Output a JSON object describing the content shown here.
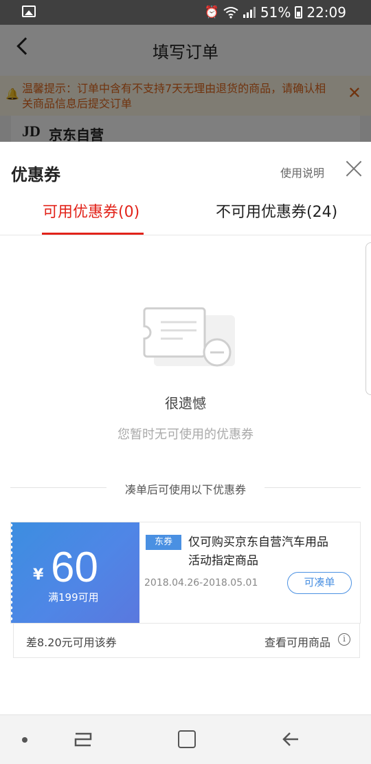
{
  "status_bar": {
    "battery": "51%",
    "time": "22:09"
  },
  "background_page": {
    "title": "填写订单",
    "tip": "温馨提示：订单中含有不支持7天无理由退货的商品，请确认相关商品信息后提交订单",
    "shop_name": "京东自营"
  },
  "sheet": {
    "title": "优惠券",
    "help_link": "使用说明",
    "tabs": [
      {
        "label": "可用优惠券(0)",
        "active": true
      },
      {
        "label": "不可用优惠券(24)",
        "active": false
      }
    ]
  },
  "empty_state": {
    "title": "很遗憾",
    "subtitle": "您暂时无可使用的优惠券"
  },
  "section_divider": "凑单后可使用以下优惠券",
  "coupon": {
    "currency": "¥",
    "amount": "60",
    "threshold": "满199可用",
    "tag": "东券",
    "description": "仅可购买京东自营汽车用品活动指定商品",
    "date_range": "2018.04.26-2018.05.01",
    "action": "可凑单",
    "shortfall": "差8.20元可用该券",
    "view_products": "查看可用商品"
  },
  "colors": {
    "accent_red": "#e2231a",
    "coupon_blue": "#4a90e2",
    "tip_orange": "#e0661c"
  }
}
